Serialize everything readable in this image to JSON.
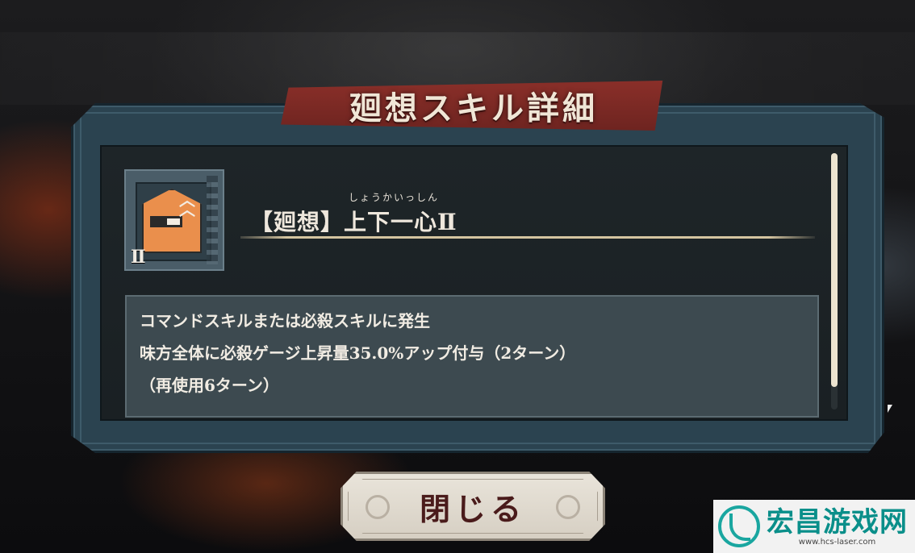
{
  "dialog": {
    "title": "廻想スキル詳細",
    "skill": {
      "level_badge": "Ⅱ",
      "furigana": "しょうかいっしん",
      "name": "【廻想】上下一心Ⅱ",
      "icon": "gauge-up-icon"
    },
    "description": [
      "コマンドスキルまたは必殺スキルに発生",
      "味方全体に必殺ゲージ上昇量35.0%アップ付与（2ターン）",
      "（再使用6ターン）"
    ],
    "close_label": "閉じる"
  },
  "watermark": {
    "title": "宏昌游戏网",
    "url": "www.hcs-laser.com"
  },
  "colors": {
    "banner": "#8a2f29",
    "frame": "#2b4350",
    "icon_badge": "#ea8f4c",
    "close_text": "#4a1b1b"
  }
}
